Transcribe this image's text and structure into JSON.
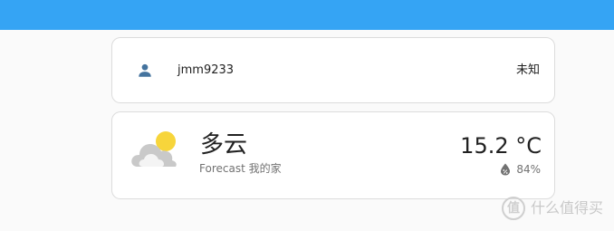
{
  "person": {
    "name": "jmm9233",
    "state": "未知",
    "icon": "account-icon"
  },
  "weather": {
    "condition": "多云",
    "forecast_name": "Forecast 我的家",
    "temperature": "15.2 °C",
    "humidity": "84%",
    "icon": "partly-cloudy-icon",
    "humidity_icon": "water-percent-icon"
  },
  "watermark": {
    "logo_text": "值",
    "text": "什么值得买"
  },
  "colors": {
    "top_bar": "#35a4f4",
    "person_icon": "#44739e",
    "sun": "#f7d53b",
    "cloud": "#c9c9c9"
  }
}
